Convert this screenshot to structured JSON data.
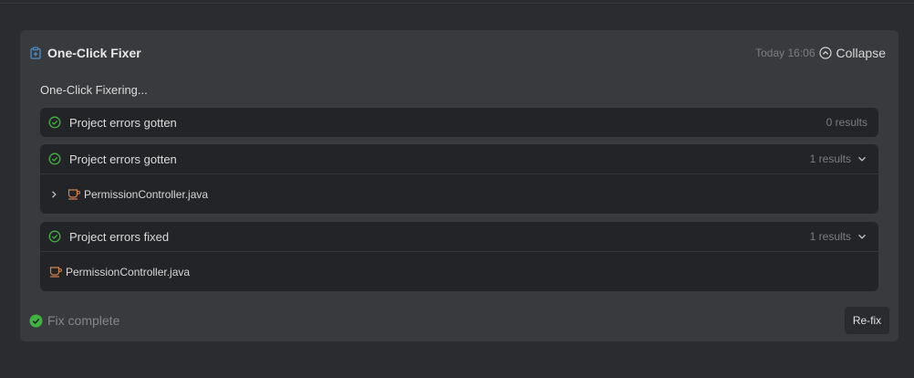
{
  "card": {
    "title": "One-Click Fixer",
    "title_icon": "clipboard-plus-icon",
    "time": "Today 16:06",
    "collapse_label": "Collapse",
    "status_text": "One-Click Fixering..."
  },
  "steps": [
    {
      "label": "Project errors gotten",
      "count": "0 results",
      "status_icon": "check-circle-icon"
    },
    {
      "label": "Project errors gotten",
      "count": "1 results",
      "status_icon": "check-circle-icon",
      "file": {
        "name": "PermissionController.java",
        "icon": "java-cup-icon",
        "expandable": true
      }
    },
    {
      "label": "Project errors fixed",
      "count": "1 results",
      "status_icon": "check-circle-icon",
      "file": {
        "name": "PermissionController.java",
        "icon": "java-cup-icon",
        "expandable": false
      }
    }
  ],
  "footer": {
    "status_text": "Fix complete",
    "refix_label": "Re-fix"
  },
  "colors": {
    "background": "#2b2c2f",
    "card": "#393a3e",
    "step": "#232427",
    "success": "#3fb33f",
    "java": "#d8824a",
    "accent_icon": "#4a90c8"
  }
}
